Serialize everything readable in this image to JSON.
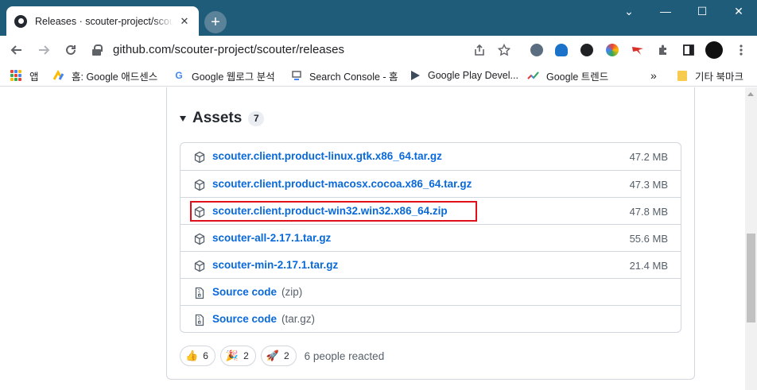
{
  "browser": {
    "tab_title": "Releases · scouter-project/scouter",
    "tab_close": "✕",
    "new_tab": "+",
    "window_controls": {
      "minimize": "⌄",
      "restore": "—",
      "maximize": "☐",
      "close": "✕"
    },
    "url": "github.com/scouter-project/scouter/releases",
    "bookmarks": [
      {
        "label": "앱",
        "icon": "apps-grid-icon"
      },
      {
        "label": "홈: Google 애드센스",
        "icon": "adsense-icon"
      },
      {
        "label": "Google 웹로그 분석",
        "icon": "google-icon"
      },
      {
        "label": "Search Console - 홈",
        "icon": "search-console-icon"
      },
      {
        "label": "Google Play Devel...",
        "icon": "play-icon"
      },
      {
        "label": "Google 트렌드",
        "icon": "trends-icon"
      }
    ],
    "bookmarks_more": "»",
    "other_bookmarks": "기타 북마크"
  },
  "assets": {
    "title": "Assets",
    "count": "7",
    "items": [
      {
        "name": "scouter.client.product-linux.gtk.x86_64.tar.gz",
        "size": "47.2 MB"
      },
      {
        "name": "scouter.client.product-macosx.cocoa.x86_64.tar.gz",
        "size": "47.3 MB"
      },
      {
        "name": "scouter.client.product-win32.win32.x86_64.zip",
        "size": "47.8 MB"
      },
      {
        "name": "scouter-all-2.17.1.tar.gz",
        "size": "55.6 MB"
      },
      {
        "name": "scouter-min-2.17.1.tar.gz",
        "size": "21.4 MB"
      },
      {
        "name": "Source code",
        "sub": "(zip)"
      },
      {
        "name": "Source code",
        "sub": "(tar.gz)"
      }
    ]
  },
  "reactions": {
    "items": [
      {
        "emoji": "👍",
        "count": "6"
      },
      {
        "emoji": "🎉",
        "count": "2"
      },
      {
        "emoji": "🚀",
        "count": "2"
      }
    ],
    "summary": "6 people reacted"
  },
  "colors": {
    "titlebar": "#1f5c7a",
    "link": "#0969da",
    "highlight": "#e0101b"
  }
}
